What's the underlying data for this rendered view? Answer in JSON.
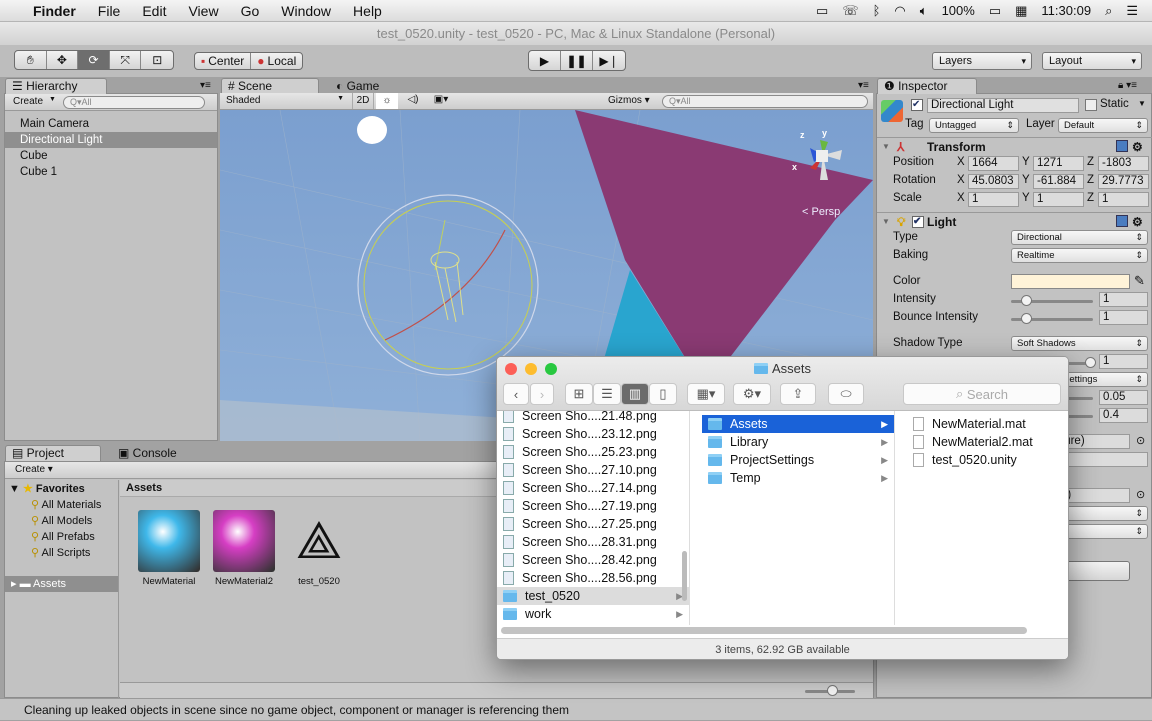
{
  "menubar": {
    "apple": "",
    "items": [
      "Finder",
      "File",
      "Edit",
      "View",
      "Go",
      "Window",
      "Help"
    ],
    "battery": "100%",
    "time": "11:30:09"
  },
  "window_title": "test_0520.unity - test_0520 - PC, Mac & Linux Standalone (Personal)",
  "toolbar": {
    "tools": [
      "hand",
      "move",
      "rotate",
      "scale",
      "rect"
    ],
    "active_tool": "rotate",
    "pivot": "Center",
    "space": "Local",
    "layers": "Layers",
    "layout": "Layout"
  },
  "hierarchy": {
    "tab": "Hierarchy",
    "create": "Create",
    "search_placeholder": "All",
    "items": [
      {
        "label": "Main Camera",
        "selected": false
      },
      {
        "label": "Directional Light",
        "selected": true
      },
      {
        "label": "Cube",
        "selected": false
      },
      {
        "label": "Cube 1",
        "selected": false
      }
    ]
  },
  "scene": {
    "tab": "Scene",
    "game_tab": "Game",
    "shading": "Shaded",
    "mode_2d": "2D",
    "gizmos": "Gizmos",
    "search_placeholder": "All",
    "persp": "Persp",
    "axes": {
      "x": "x",
      "y": "y",
      "z": "z"
    }
  },
  "inspector": {
    "tab": "Inspector",
    "object_name": "Directional Light",
    "static": "Static",
    "tag_label": "Tag",
    "tag": "Untagged",
    "layer_label": "Layer",
    "layer": "Default",
    "transform": {
      "title": "Transform",
      "position_label": "Position",
      "rotation_label": "Rotation",
      "scale_label": "Scale",
      "position": [
        "1664",
        "1271",
        "-1803"
      ],
      "rotation": [
        "45.0803",
        "-61.884",
        "29.7773"
      ],
      "scale": [
        "1",
        "1",
        "1"
      ],
      "axis": [
        "X",
        "Y",
        "Z"
      ]
    },
    "light": {
      "title": "Light",
      "type_label": "Type",
      "type": "Directional",
      "baking_label": "Baking",
      "baking": "Realtime",
      "color_label": "Color",
      "color": "#fff3d8",
      "intensity_label": "Intensity",
      "intensity": "1",
      "intensity_fraction": 0.125,
      "bounce_label": "Bounce Intensity",
      "bounce": "1",
      "bounce_fraction": 0.125,
      "shadow_label": "Shadow Type",
      "shadow": "Soft Shadows",
      "strength": "1",
      "resolution": "Settings",
      "bias": "0.05",
      "normal_bias": "0.4",
      "cookie": "ture)",
      "flare": "e)"
    }
  },
  "project": {
    "tab": "Project",
    "console_tab": "Console",
    "create": "Create",
    "favorites": "Favorites",
    "fav_items": [
      "All Materials",
      "All Models",
      "All Prefabs",
      "All Scripts"
    ],
    "assets_root": "Assets",
    "breadcrumb": "Assets",
    "assets": [
      {
        "label": "NewMaterial",
        "color": "#3fb8ea"
      },
      {
        "label": "NewMaterial2",
        "color": "#d63ec4"
      },
      {
        "label": "test_0520",
        "color": ""
      }
    ]
  },
  "finder": {
    "title": "Assets",
    "search_placeholder": "Search",
    "col1": [
      "Screen Sho....21.48.png",
      "Screen Sho....23.12.png",
      "Screen Sho....25.23.png",
      "Screen Sho....27.10.png",
      "Screen Sho....27.14.png",
      "Screen Sho....27.19.png",
      "Screen Sho....27.25.png",
      "Screen Sho....28.31.png",
      "Screen Sho....28.42.png",
      "Screen Sho....28.56.png"
    ],
    "col1_folders": [
      "test_0520",
      "work"
    ],
    "col2": [
      "Assets",
      "Library",
      "ProjectSettings",
      "Temp"
    ],
    "col3": [
      "NewMaterial.mat",
      "NewMaterial2.mat",
      "test_0520.unity"
    ],
    "status": "3 items, 62.92 GB available"
  },
  "status_bar": "Cleaning up leaked objects in scene since no game object, component or manager is referencing them"
}
